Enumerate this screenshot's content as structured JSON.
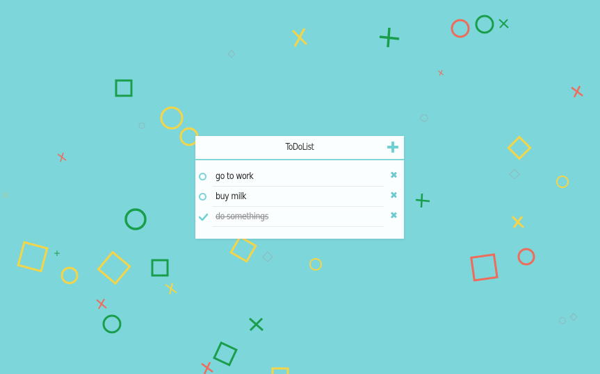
{
  "app": {
    "title": "ToDoList"
  },
  "todos": [
    {
      "text": "go to work",
      "completed": false
    },
    {
      "text": "buy milk",
      "completed": false
    },
    {
      "text": "do somethings",
      "completed": true
    }
  ],
  "colors": {
    "background": "#7dd6da",
    "accent": "#6fd0d6",
    "shape_yellow": "#f5d547",
    "shape_green": "#1a9e4c",
    "shape_red": "#ef6b5a"
  },
  "icons": {
    "add": "plus-icon",
    "open": "circle-icon",
    "done": "checkmark-icon",
    "delete": "close-icon"
  }
}
